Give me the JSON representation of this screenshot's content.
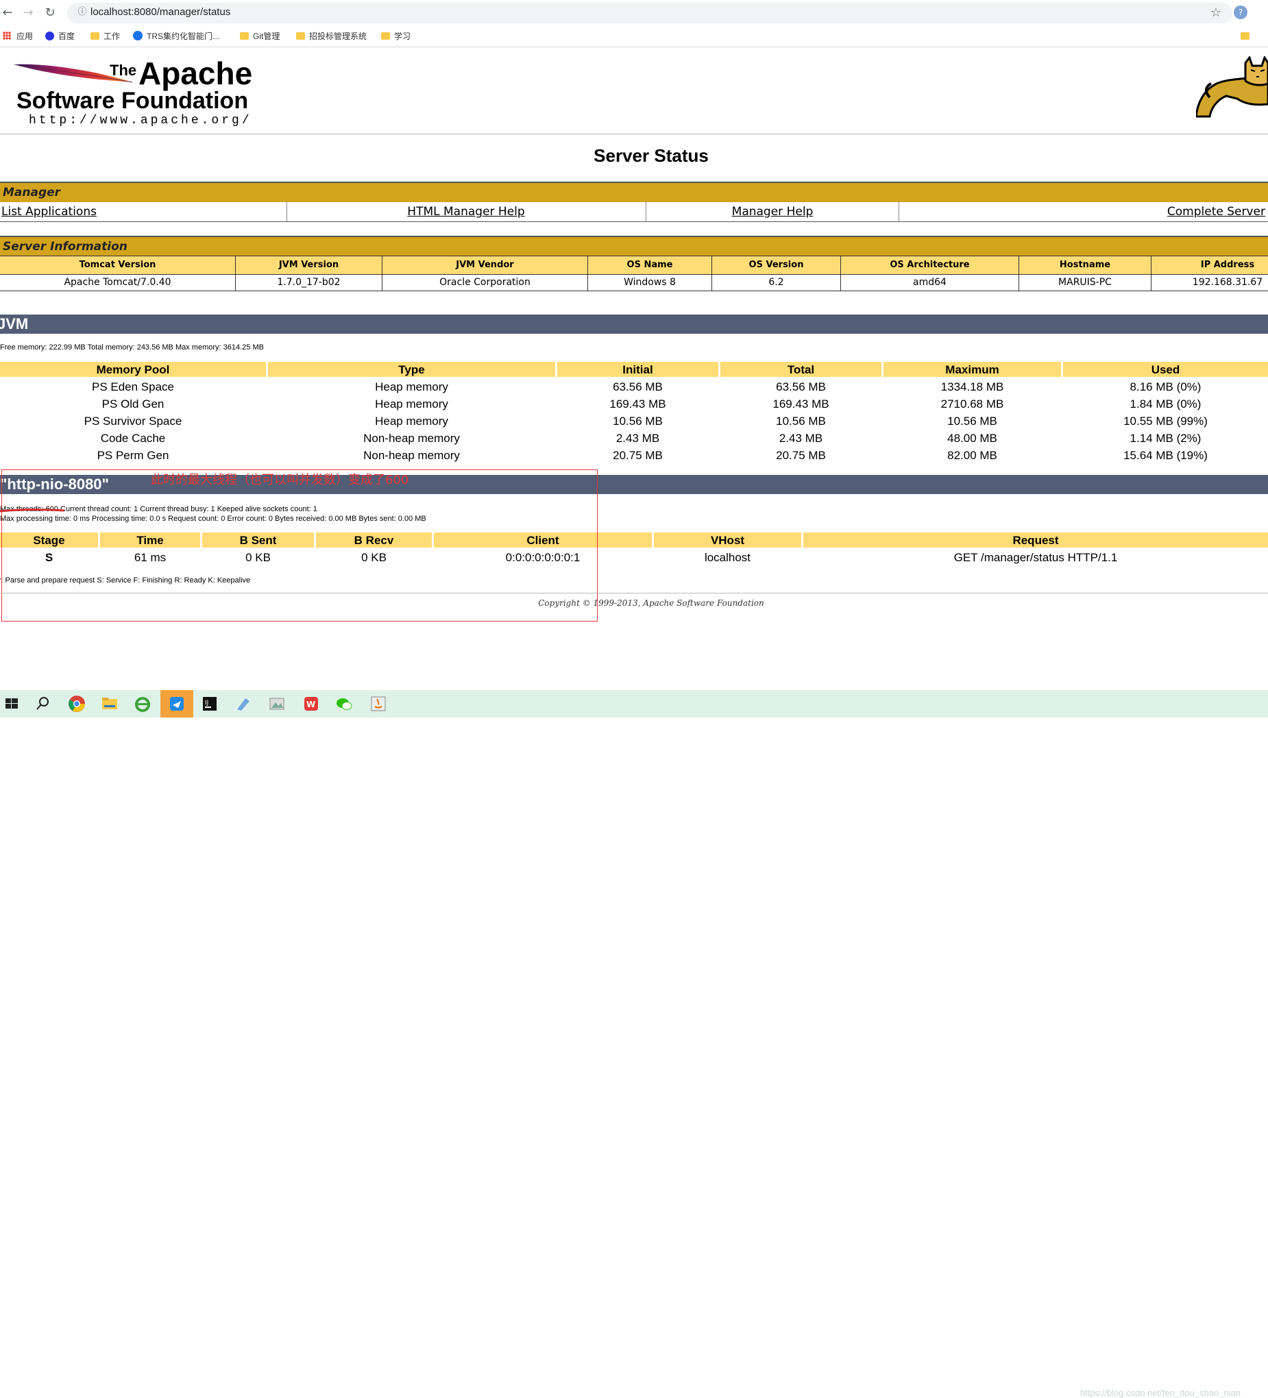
{
  "browser": {
    "url": "localhost:8080/manager/status",
    "bookmarks": [
      "应用",
      "百度",
      "工作",
      "TRS集约化智能门...",
      "Git管理",
      "招投标管理系统",
      "学习"
    ]
  },
  "logo": {
    "the": "The",
    "apache": "Apache",
    "foundation": "Software Foundation",
    "url": "http://www.apache.org/"
  },
  "page_title": "Server Status",
  "manager": {
    "heading": "Manager",
    "links": [
      "List Applications",
      "HTML Manager Help",
      "Manager Help",
      "Complete Server"
    ]
  },
  "server_info": {
    "heading": "Server Information",
    "headers": [
      "Tomcat Version",
      "JVM Version",
      "JVM Vendor",
      "OS Name",
      "OS Version",
      "OS Architecture",
      "Hostname",
      "IP Address"
    ],
    "values": [
      "Apache Tomcat/7.0.40",
      "1.7.0_17-b02",
      "Oracle Corporation",
      "Windows 8",
      "6.2",
      "amd64",
      "MARUIS-PC",
      "192.168.31.67"
    ]
  },
  "jvm": {
    "heading": "JVM",
    "memory_line": "Free memory: 222.99 MB Total memory: 243.56 MB Max memory: 3614.25 MB",
    "headers": [
      "Memory Pool",
      "Type",
      "Initial",
      "Total",
      "Maximum",
      "Used"
    ],
    "rows": [
      [
        "PS Eden Space",
        "Heap memory",
        "63.56 MB",
        "63.56 MB",
        "1334.18 MB",
        "8.16 MB (0%)"
      ],
      [
        "PS Old Gen",
        "Heap memory",
        "169.43 MB",
        "169.43 MB",
        "2710.68 MB",
        "1.84 MB (0%)"
      ],
      [
        "PS Survivor Space",
        "Heap memory",
        "10.56 MB",
        "10.56 MB",
        "10.56 MB",
        "10.55 MB (99%)"
      ],
      [
        "Code Cache",
        "Non-heap memory",
        "2.43 MB",
        "2.43 MB",
        "48.00 MB",
        "1.14 MB (2%)"
      ],
      [
        "PS Perm Gen",
        "Non-heap memory",
        "20.75 MB",
        "20.75 MB",
        "82.00 MB",
        "15.64 MB (19%)"
      ]
    ]
  },
  "connector": {
    "heading": "\"http-nio-8080\"",
    "annotation": "此时的最大线程（也可以叫并发数）变成了600",
    "line1": "Max threads: 600 Current thread count: 1 Current thread busy: 1 Keeped alive sockets count: 1",
    "line2": "Max processing time: 0 ms Processing time: 0.0 s Request count: 0 Error count: 0 Bytes received: 0.00 MB Bytes sent: 0.00 MB",
    "headers": [
      "Stage",
      "Time",
      "B Sent",
      "B Recv",
      "Client",
      "VHost",
      "Request"
    ],
    "row": [
      "S",
      "61 ms",
      "0 KB",
      "0 KB",
      "0:0:0:0:0:0:0:1",
      "localhost",
      "GET /manager/status HTTP/1.1"
    ],
    "legend": "P: Parse and prepare request S: Service F: Finishing R: Ready K: Keepalive"
  },
  "copyright": "Copyright © 1999-2013, Apache Software Foundation",
  "watermark": "https://blog.csdn.net/fen_dou_shao_nian"
}
